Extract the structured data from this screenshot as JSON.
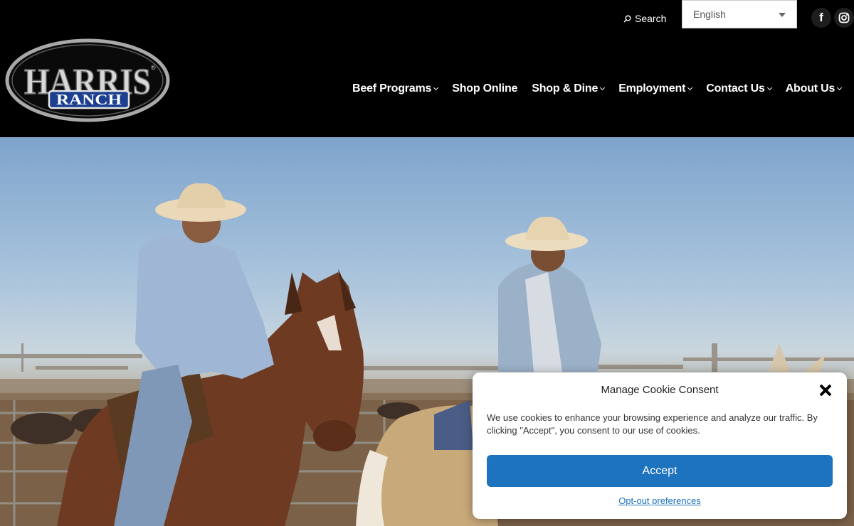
{
  "topbar": {
    "search_label": "Search",
    "search_icon": "search-icon",
    "language": {
      "selected": "English",
      "icon": "chevron-down-icon"
    },
    "social": [
      {
        "name": "facebook",
        "glyph": "f",
        "icon": "facebook-icon"
      },
      {
        "name": "instagram",
        "icon": "instagram-icon"
      }
    ]
  },
  "logo": {
    "line1": "HARRIS",
    "line2": "RANCH",
    "registered": "®"
  },
  "nav": {
    "items": [
      {
        "label": "Beef Programs",
        "has_dropdown": true
      },
      {
        "label": "Shop Online",
        "has_dropdown": false
      },
      {
        "label": "Shop & Dine",
        "has_dropdown": true
      },
      {
        "label": "Employment",
        "has_dropdown": true
      },
      {
        "label": "Contact Us",
        "has_dropdown": true
      },
      {
        "label": "About Us",
        "has_dropdown": true
      }
    ]
  },
  "hero": {
    "image": "two-cowboys-on-horses-at-feedlot"
  },
  "cookie_consent": {
    "title": "Manage Cookie Consent",
    "close_icon": "close-icon",
    "text": "We use cookies to enhance your browsing experience and analyze our traffic. By clicking \"Accept\", you consent to our use of cookies.",
    "accept_label": "Accept",
    "optout_label": "Opt-out preferences"
  },
  "colors": {
    "header_bg": "#000000",
    "accept_button": "#1e73be",
    "link": "#1e73be",
    "logo_blue": "#1d3f8f"
  }
}
